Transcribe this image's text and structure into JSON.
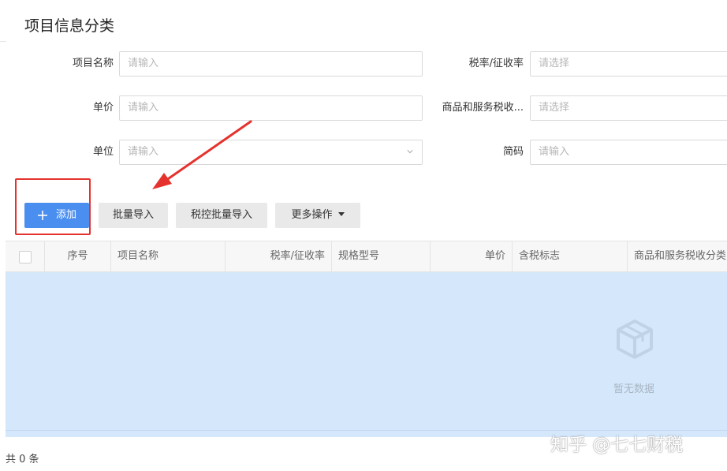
{
  "page": {
    "title": "项目信息分类"
  },
  "form": {
    "fields": [
      {
        "label": "项目名称",
        "placeholder": "请输入"
      },
      {
        "label": "税率/征收率",
        "placeholder": "请选择"
      },
      {
        "label": "单价",
        "placeholder": "请输入"
      },
      {
        "label": "商品和服务税收...",
        "placeholder": "请选择"
      },
      {
        "label": "单位",
        "placeholder": "请输入",
        "icon": "chevron-down-icon"
      },
      {
        "label": "简码",
        "placeholder": "请输入"
      }
    ]
  },
  "toolbar": {
    "add_label": "添加",
    "batch_import_label": "批量导入",
    "tax_batch_import_label": "税控批量导入",
    "more_label": "更多操作"
  },
  "table": {
    "columns": [
      "序号",
      "项目名称",
      "税率/征收率",
      "规格型号",
      "单价",
      "含税标志",
      "商品和服务税收分类"
    ],
    "empty_text": "暂无数据"
  },
  "footer": {
    "total": "共 0 条"
  },
  "watermark": "知乎 @七七财税",
  "colors": {
    "primary": "#4a8ff0",
    "annotation": "#e5322d",
    "table_body": "#d5e8fb"
  }
}
